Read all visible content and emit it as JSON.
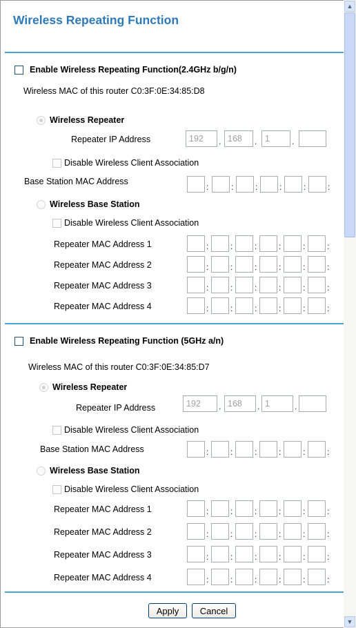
{
  "page": {
    "title": "Wireless Repeating Function"
  },
  "section_24": {
    "enable_label": "Enable Wireless Repeating Function(2.4GHz b/g/n)",
    "mac_text": "Wireless MAC of this router C0:3F:0E:34:85:D8",
    "repeater_label": "Wireless Repeater",
    "repeater_ip_label": "Repeater IP Address",
    "ip": [
      "192",
      "168",
      "1",
      ""
    ],
    "disable_client_label": "Disable Wireless Client Association",
    "base_mac_label": "Base Station MAC Address",
    "base_station_label": "Wireless Base Station",
    "disable_client_label2": "Disable Wireless Client Association",
    "repeater_mac_labels": [
      "Repeater MAC Address 1",
      "Repeater MAC Address 2",
      "Repeater MAC Address 3",
      "Repeater MAC Address 4"
    ]
  },
  "section_5": {
    "enable_label": "Enable Wireless Repeating Function (5GHz a/n)",
    "mac_text": "Wireless MAC of this router C0:3F:0E:34:85:D7",
    "repeater_label": "Wireless Repeater",
    "repeater_ip_label": "Repeater IP Address",
    "ip": [
      "192",
      "168",
      "1",
      ""
    ],
    "disable_client_label": "Disable Wireless Client Association",
    "base_mac_label": "Base Station MAC Address",
    "base_station_label": "Wireless Base Station",
    "disable_client_label2": "Disable Wireless Client Association",
    "repeater_mac_labels": [
      "Repeater MAC Address 1",
      "Repeater MAC Address 2",
      "Repeater MAC Address 3",
      "Repeater MAC Address 4"
    ]
  },
  "buttons": {
    "apply": "Apply",
    "cancel": "Cancel"
  },
  "icons": {
    "scroll_up": "chevron-up-icon",
    "scroll_down": "chevron-down-icon"
  },
  "colors": {
    "title": "#2e79b9",
    "rule": "#4da3d6"
  }
}
